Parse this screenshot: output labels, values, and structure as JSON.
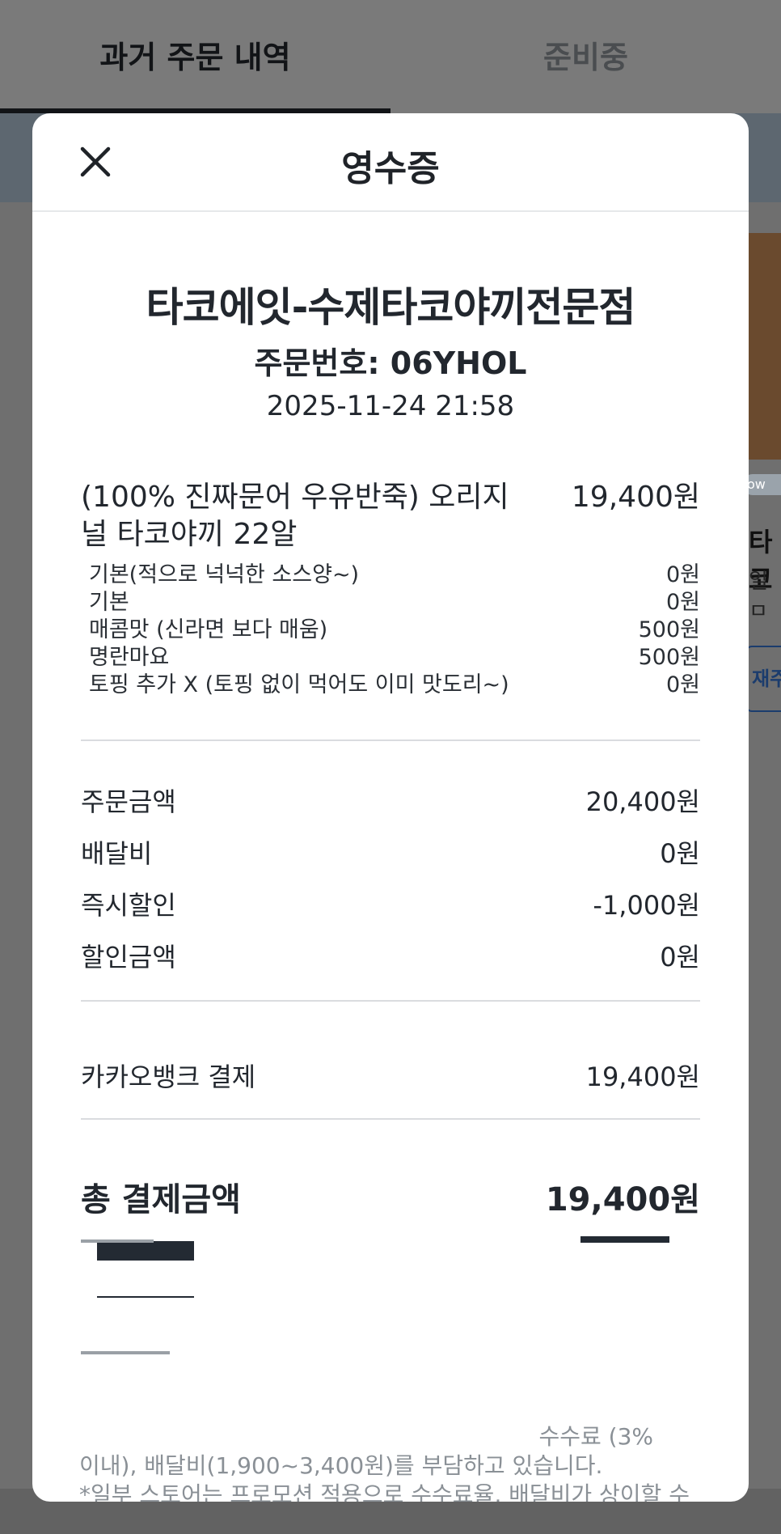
{
  "background": {
    "tabs": {
      "past_orders": "과거 주문 내역",
      "preparing": "준비중"
    },
    "badge": "ow",
    "fragment_title": "타코",
    "fragment_sub": "일 ㅁ",
    "fragment_button": "재주"
  },
  "modal": {
    "title": "영수증",
    "close_icon": "close-icon"
  },
  "receipt": {
    "store_name": "타코에잇-수제타코야끼전문점",
    "order_number": "주문번호: 06YHOL",
    "order_datetime": "2025-11-24 21:58",
    "item": {
      "name": "(100% 진짜문어 우유반죽) 오리지널 타코야끼 22알",
      "price": "19,400원",
      "options": [
        {
          "label": "기본(적으로 넉넉한 소스양~)",
          "price": "0원"
        },
        {
          "label": "기본",
          "price": "0원"
        },
        {
          "label": "매콤맛 (신라면 보다 매움)",
          "price": "500원"
        },
        {
          "label": "명란마요",
          "price": "500원"
        },
        {
          "label": "토핑 추가 X (토핑 없이 먹어도 이미 맛도리~)",
          "price": "0원"
        }
      ]
    },
    "summary": [
      {
        "label": "주문금액",
        "value": "20,400원"
      },
      {
        "label": "배달비",
        "value": "0원"
      },
      {
        "label": "즉시할인",
        "value": "-1,000원"
      },
      {
        "label": "할인금액",
        "value": "0원"
      }
    ],
    "payment": {
      "label": "카카오뱅크 결제",
      "value": "19,400원"
    },
    "total": {
      "label": "총 결제금액",
      "value": "19,400원"
    },
    "notice_line1": "수수료 (3%",
    "notice_line2": "이내), 배달비(1,900~3,400원)를 부담하고 있습니다.",
    "notice_line3": "*일부 스토어는 프로모션 적용으로 수수료율, 배달비가 상이할 수"
  },
  "colors": {
    "overlay": "#6f6f6f",
    "modal_bg": "#ffffff",
    "text": "#22272e",
    "divider": "#dadcdf",
    "notice_text": "#8a9096"
  }
}
